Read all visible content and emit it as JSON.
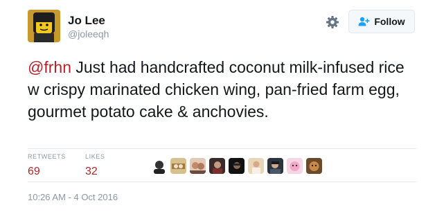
{
  "author": {
    "display_name": "Jo Lee",
    "handle": "@joleeqh"
  },
  "actions": {
    "follow_label": "Follow",
    "settings_icon": "gear-icon",
    "follow_icon": "add-user-icon"
  },
  "tweet": {
    "mention": "@frhn",
    "text": " Just had handcrafted coconut milk-infused rice w crispy marinated chicken wing, pan-fried farm egg, gourmet potato cake & anchovies."
  },
  "stats": {
    "retweets_label": "RETWEETS",
    "retweets_count": "69",
    "likes_label": "LIKES",
    "likes_count": "32"
  },
  "timestamp": "10:26 AM - 4 Oct 2016",
  "colors": {
    "accent": "#b0242a",
    "muted": "#8899a6",
    "divider": "#e1e8ed"
  }
}
